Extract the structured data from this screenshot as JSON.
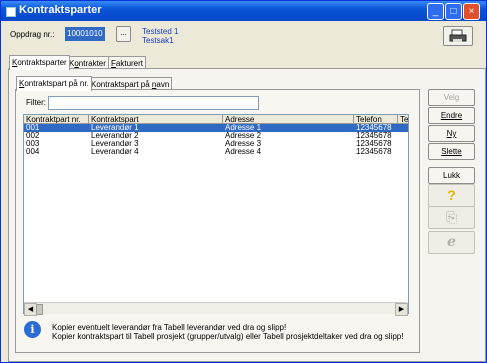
{
  "window": {
    "title": "Kontraktsparter"
  },
  "header": {
    "oppdrag_label": "Oppdrag nr.:",
    "oppdrag_value": "10001010",
    "browse_label": "...",
    "line1": "Teststed 1",
    "line2": "Testsak1",
    "print_icon": "printer-icon"
  },
  "main_tabs": [
    {
      "label": "Kontraktsparter",
      "underline": "K"
    },
    {
      "label": "Kontrakter",
      "underline": "o"
    },
    {
      "label": "Fakturert",
      "underline": "F"
    }
  ],
  "sub_tabs": [
    {
      "label": "Kontraktspart på nr.",
      "underline": "K"
    },
    {
      "label": "Kontraktspart på navn",
      "underline": "n"
    }
  ],
  "filter": {
    "label": "Filter:",
    "value": ""
  },
  "table": {
    "columns": [
      "Kontraktpart nr.",
      "Kontraktspart",
      "Adresse",
      "Telefon",
      "Te"
    ],
    "rows": [
      {
        "nr": "001",
        "part": "Leverandør 1",
        "adresse": "Adresse 1",
        "telefon": "12345678",
        "selected": true
      },
      {
        "nr": "002",
        "part": "Leverandør 2",
        "adresse": "Adresse 2",
        "telefon": "12345678",
        "selected": false
      },
      {
        "nr": "003",
        "part": "Leverandør 3",
        "adresse": "Adresse 3",
        "telefon": "12345678",
        "selected": false
      },
      {
        "nr": "004",
        "part": "Leverandør 4",
        "adresse": "Adresse 4",
        "telefon": "12345678",
        "selected": false
      }
    ]
  },
  "buttons": {
    "velg": "Velg",
    "endre": "Endre",
    "ny": "Ny",
    "slette": "Slette",
    "lukk": "Lukk"
  },
  "side_icons": [
    "help-icon",
    "transfer-icon",
    "internet-explorer-icon"
  ],
  "info": {
    "line1": "Kopier eventuelt leverandør fra Tabell leverandør ved dra og slipp!",
    "line2": "Kopier kontraktspart til Tabell prosjekt (grupper/utvalg) eller Tabell prosjektdeltaker ved dra og slipp!"
  },
  "colors": {
    "titlebar": "#0a55d8",
    "selection": "#316ac5",
    "link_text": "#1a3cc8"
  }
}
